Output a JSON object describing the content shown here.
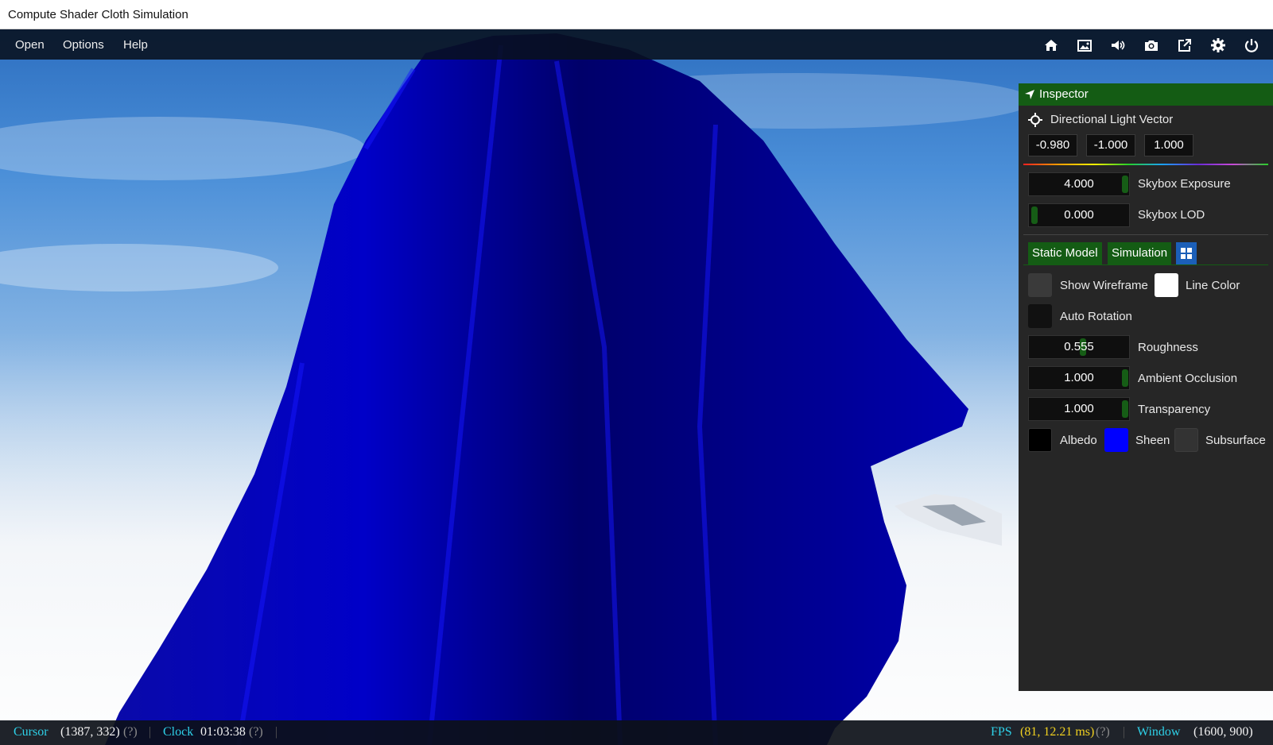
{
  "window": {
    "title": "Compute Shader Cloth Simulation"
  },
  "menu": {
    "open": "Open",
    "options": "Options",
    "help": "Help"
  },
  "toolbar": {
    "icons": [
      "home-icon",
      "image-icon",
      "volume-icon",
      "camera-icon",
      "external-link-icon",
      "gear-icon",
      "power-icon"
    ]
  },
  "inspector": {
    "title": "Inspector",
    "light": {
      "label": "Directional Light Vector",
      "x": "-0.980",
      "y": "-1.000",
      "z": "1.000"
    },
    "skybox_exposure": {
      "value": "4.000",
      "label": "Skybox Exposure",
      "fill": 1.0
    },
    "skybox_lod": {
      "value": "0.000",
      "label": "Skybox LOD",
      "fill": 0.0
    },
    "tabs": {
      "static_model": "Static Model",
      "simulation": "Simulation"
    },
    "show_wireframe": {
      "label": "Show Wireframe",
      "checked": false
    },
    "line_color": {
      "label": "Line Color",
      "color": "#ffffff"
    },
    "auto_rotation": {
      "label": "Auto Rotation",
      "checked": false
    },
    "roughness": {
      "value": "0.555",
      "label": "Roughness",
      "fill": 0.555
    },
    "ambient_occlusion": {
      "value": "1.000",
      "label": "Ambient Occlusion",
      "fill": 1.0
    },
    "transparency": {
      "value": "1.000",
      "label": "Transparency",
      "fill": 1.0
    },
    "albedo": {
      "label": "Albedo",
      "color": "#000000"
    },
    "sheen": {
      "label": "Sheen",
      "color": "#0000ff"
    },
    "subsurface": {
      "label": "Subsurface",
      "color": "#333333"
    }
  },
  "status": {
    "cursor_label": "Cursor",
    "cursor_value": "(1387, 332)",
    "clock_label": "Clock",
    "clock_value": "01:03:38",
    "fps_label": "FPS",
    "fps_value": "(81, 12.21 ms)",
    "window_label": "Window",
    "window_value": "(1600, 900)",
    "help_mark": "(?)"
  },
  "colors": {
    "accent_green": "#145c14",
    "cloth_blue": "#0000d8",
    "status_cyan": "#2ed1e8",
    "status_yellow": "#f0d020"
  }
}
